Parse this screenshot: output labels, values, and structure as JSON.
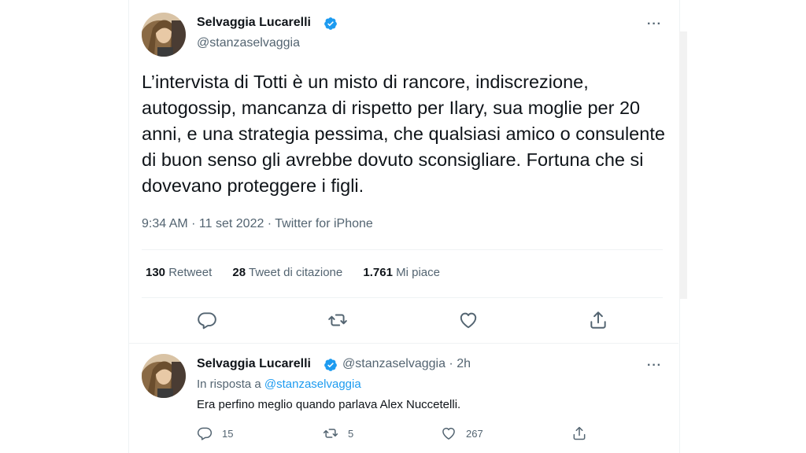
{
  "main_tweet": {
    "author_name": "Selvaggia Lucarelli",
    "handle": "@stanzaselvaggia",
    "more": "···",
    "text": "L’intervista di Totti è un misto di rancore, indiscrezione, autogossip, mancanza di rispetto per Ilary, sua moglie per 20 anni, e una strategia pessima, che qualsiasi amico o consulente di buon senso gli avrebbe dovuto sconsigliare. Fortuna che si dovevano proteggere i figli.",
    "meta": "9:34 AM · 11 set 2022 · Twitter for iPhone",
    "stats": [
      {
        "count": "130",
        "label": "Retweet"
      },
      {
        "count": "28",
        "label": "Tweet di citazione"
      },
      {
        "count": "1.761",
        "label": "Mi piace"
      }
    ],
    "actions": [
      "reply-icon",
      "retweet-icon",
      "like-icon",
      "share-icon"
    ]
  },
  "reply_tweet": {
    "author_name": "Selvaggia Lucarelli",
    "handle_time": "@stanzaselvaggia · 2h",
    "more": "···",
    "reply_prefix": "In risposta a",
    "reply_to": "@stanzaselvaggia",
    "text": "Era perfino meglio quando parlava Alex Nuccetelli.",
    "replies": "15",
    "retweets": "5",
    "likes": "267"
  },
  "colors": {
    "text": "#0f1419",
    "secondary": "#536471",
    "accent": "#1d9bf0",
    "divider": "#eff3f4"
  }
}
